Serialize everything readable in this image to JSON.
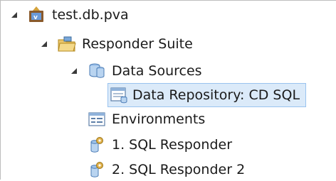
{
  "tree": {
    "items": [
      {
        "label": "test.db.pva",
        "icon": "project-icon",
        "expanded": true
      },
      {
        "label": "Responder Suite",
        "icon": "suite-folder-icon",
        "expanded": true
      },
      {
        "label": "Data Sources",
        "icon": "data-sources-icon",
        "expanded": true
      },
      {
        "label": "Data Repository: CD SQL",
        "icon": "data-repository-icon",
        "selected": true
      },
      {
        "label": "Environments",
        "icon": "environments-icon"
      },
      {
        "label": "1. SQL Responder",
        "icon": "sql-responder-icon"
      },
      {
        "label": "2. SQL Responder 2",
        "icon": "sql-responder-icon"
      }
    ]
  },
  "colors": {
    "selection_bg": "#dbeaf9",
    "selection_border": "#99c3ef",
    "twisty": "#3a3a3a"
  }
}
